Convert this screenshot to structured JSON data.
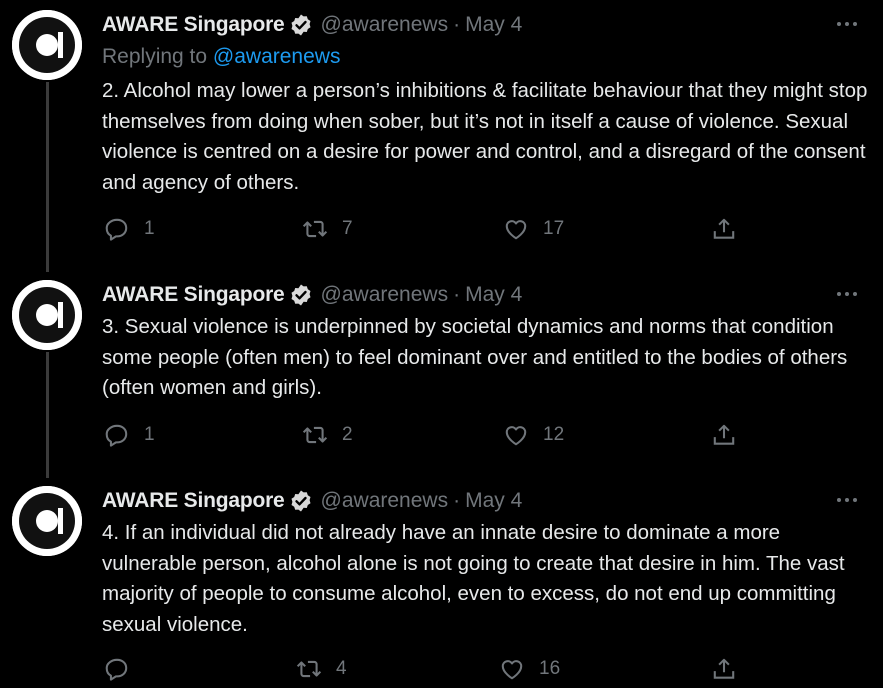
{
  "tweets": [
    {
      "author_name": "AWARE Singapore",
      "handle": "@awarenews",
      "separator": "·",
      "date": "May 4",
      "replying_prefix": "Replying to",
      "replying_to": "@awarenews",
      "text": "2. Alcohol may lower a person’s inhibitions & facilitate behaviour that they might stop themselves from doing when sober, but it’s not in itself a cause of violence. Sexual violence is centred on a desire for power and control, and a disregard of the consent and agency of others.",
      "replies": "1",
      "retweets": "7",
      "likes": "17"
    },
    {
      "author_name": "AWARE Singapore",
      "handle": "@awarenews",
      "separator": "·",
      "date": "May 4",
      "text": "3. Sexual violence is underpinned by societal dynamics and norms that condition some people (often men) to feel dominant over and entitled to the bodies of others (often women and girls).",
      "replies": "1",
      "retweets": "2",
      "likes": "12"
    },
    {
      "author_name": "AWARE Singapore",
      "handle": "@awarenews",
      "separator": "·",
      "date": "May 4",
      "text": "4. If an individual did not already have an innate desire to dominate a more vulnerable person, alcohol alone is not going to create that desire in him. The vast majority of people to consume alcohol, even to excess, do not end up committing sexual violence.",
      "replies": "",
      "retweets": "4",
      "likes": "16"
    }
  ],
  "icons": {
    "avatar": "aware-logo-icon",
    "verified": "verified-badge-icon",
    "more": "more-options-icon",
    "reply": "reply-icon",
    "retweet": "retweet-icon",
    "like": "heart-icon",
    "share": "share-icon"
  },
  "colors": {
    "background": "#000000",
    "text": "#e7e9ea",
    "secondary": "#71767b",
    "link": "#1d9bf0",
    "thread_line": "#3b3b3b"
  }
}
